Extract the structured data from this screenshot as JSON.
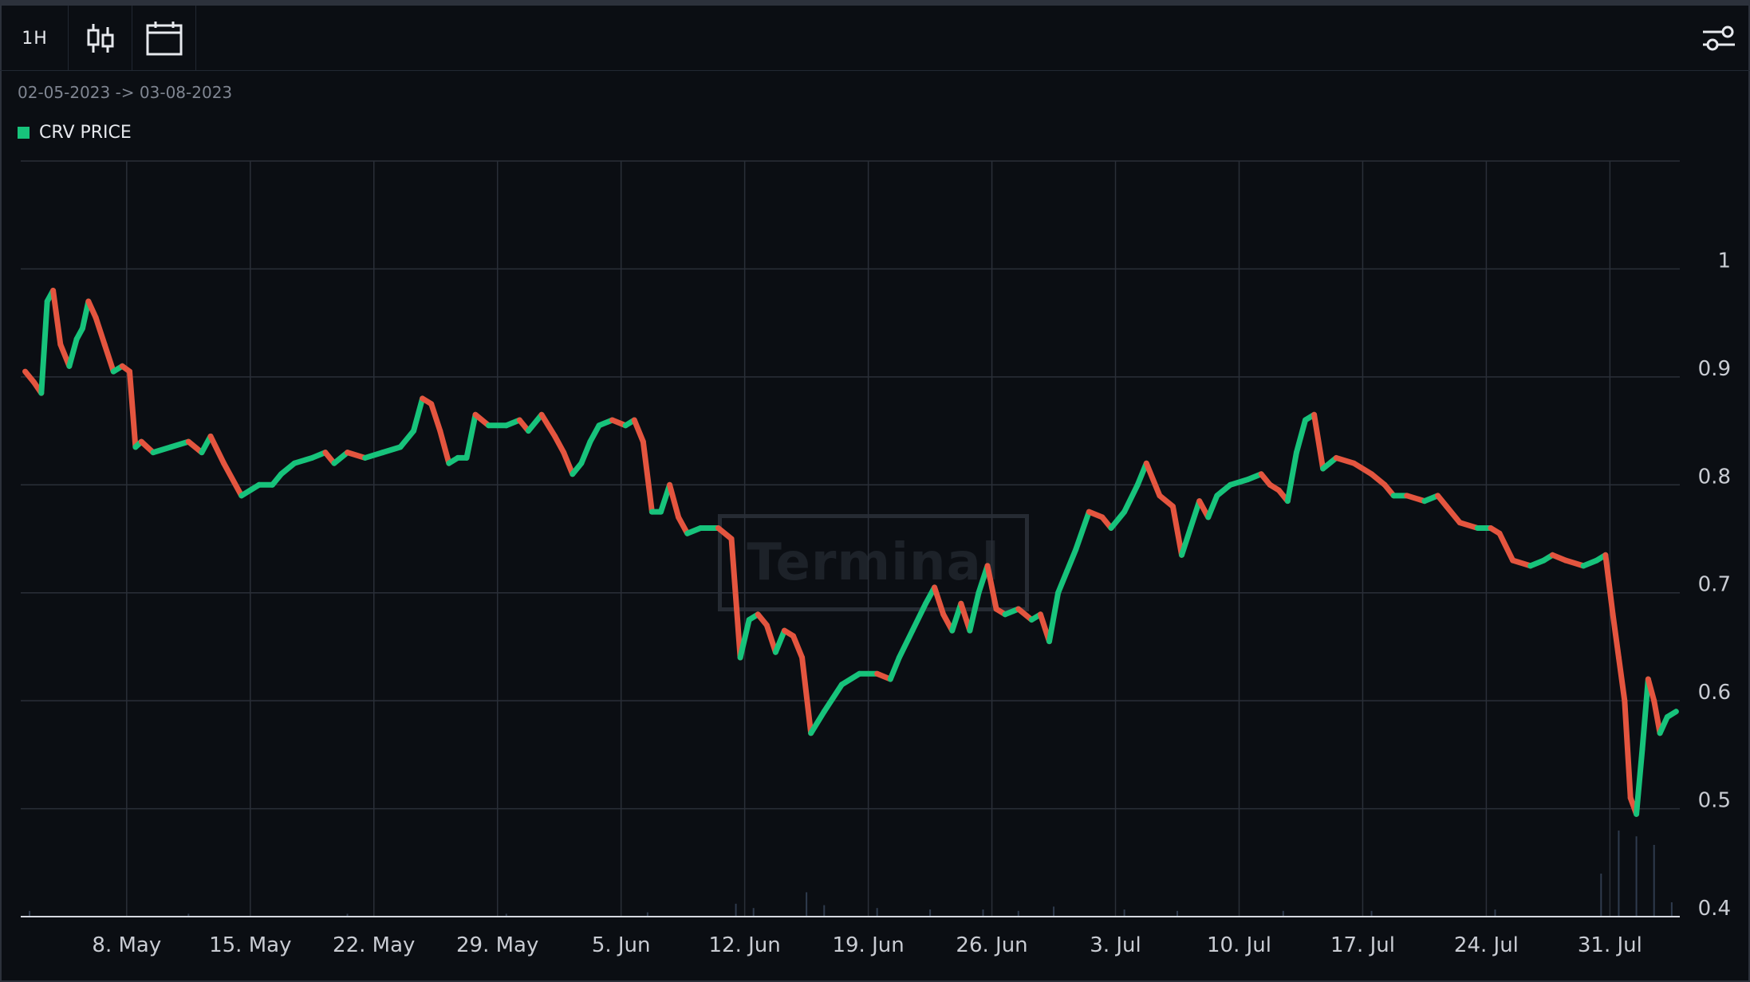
{
  "toolbar": {
    "interval_label": "1H",
    "candle_icon": "candlestick-icon",
    "calendar_icon": "calendar-icon",
    "settings_icon": "sliders-icon"
  },
  "date_range": "02-05-2023 -> 03-08-2023",
  "watermark": "Terminal",
  "colors": {
    "background": "#0b0e13",
    "grid": "#2a2f38",
    "up": "#17c37b",
    "down": "#e4553f",
    "volume": "#2f3b4e"
  },
  "chart_data": {
    "type": "line",
    "title": "",
    "legend": [
      {
        "name": "CRV PRICE",
        "color": "#17c37b"
      }
    ],
    "xlabel": "",
    "ylabel": "",
    "ylim": [
      0.4,
      1.1
    ],
    "yticks": [
      0.4,
      0.5,
      0.6,
      0.7,
      0.8,
      0.9,
      1
    ],
    "ytick_labels": [
      "0.4",
      "0.5",
      "0.6",
      "0.7",
      "0.8",
      "0.9",
      "1"
    ],
    "x_range": [
      "2023-05-02",
      "2023-08-03"
    ],
    "xticks": [
      "8. May",
      "15. May",
      "22. May",
      "29. May",
      "5. Jun",
      "12. Jun",
      "19. Jun",
      "26. Jun",
      "3. Jul",
      "10. Jul",
      "17. Jul",
      "24. Jul",
      "31. Jul"
    ],
    "xtick_dates": [
      "2023-05-08",
      "2023-05-15",
      "2023-05-22",
      "2023-05-29",
      "2023-06-05",
      "2023-06-12",
      "2023-06-19",
      "2023-06-26",
      "2023-07-03",
      "2023-07-10",
      "2023-07-17",
      "2023-07-24",
      "2023-07-31"
    ],
    "grid": true,
    "series": [
      {
        "name": "CRV PRICE",
        "points": [
          [
            "2023-05-02",
            0.905
          ],
          [
            "2023-05-02",
            0.895
          ],
          [
            "2023-05-03",
            0.885
          ],
          [
            "2023-05-03",
            0.97
          ],
          [
            "2023-05-03",
            0.98
          ],
          [
            "2023-05-04",
            0.93
          ],
          [
            "2023-05-04",
            0.91
          ],
          [
            "2023-05-05",
            0.935
          ],
          [
            "2023-05-05",
            0.945
          ],
          [
            "2023-05-05",
            0.97
          ],
          [
            "2023-05-06",
            0.955
          ],
          [
            "2023-05-06",
            0.93
          ],
          [
            "2023-05-07",
            0.905
          ],
          [
            "2023-05-07",
            0.91
          ],
          [
            "2023-05-08",
            0.905
          ],
          [
            "2023-05-08",
            0.835
          ],
          [
            "2023-05-08",
            0.84
          ],
          [
            "2023-05-09",
            0.83
          ],
          [
            "2023-05-10",
            0.835
          ],
          [
            "2023-05-11",
            0.84
          ],
          [
            "2023-05-12",
            0.83
          ],
          [
            "2023-05-12",
            0.845
          ],
          [
            "2023-05-13",
            0.82
          ],
          [
            "2023-05-14",
            0.79
          ],
          [
            "2023-05-15",
            0.8
          ],
          [
            "2023-05-16",
            0.8
          ],
          [
            "2023-05-16",
            0.81
          ],
          [
            "2023-05-17",
            0.82
          ],
          [
            "2023-05-18",
            0.825
          ],
          [
            "2023-05-19",
            0.83
          ],
          [
            "2023-05-19",
            0.82
          ],
          [
            "2023-05-20",
            0.83
          ],
          [
            "2023-05-21",
            0.825
          ],
          [
            "2023-05-22",
            0.83
          ],
          [
            "2023-05-23",
            0.835
          ],
          [
            "2023-05-24",
            0.85
          ],
          [
            "2023-05-24",
            0.88
          ],
          [
            "2023-05-25",
            0.875
          ],
          [
            "2023-05-25",
            0.85
          ],
          [
            "2023-05-26",
            0.82
          ],
          [
            "2023-05-26",
            0.825
          ],
          [
            "2023-05-27",
            0.825
          ],
          [
            "2023-05-27",
            0.865
          ],
          [
            "2023-05-28",
            0.855
          ],
          [
            "2023-05-29",
            0.855
          ],
          [
            "2023-05-30",
            0.86
          ],
          [
            "2023-05-30",
            0.85
          ],
          [
            "2023-05-31",
            0.865
          ],
          [
            "2023-06-01",
            0.845
          ],
          [
            "2023-06-01",
            0.83
          ],
          [
            "2023-06-02",
            0.81
          ],
          [
            "2023-06-02",
            0.82
          ],
          [
            "2023-06-03",
            0.84
          ],
          [
            "2023-06-03",
            0.855
          ],
          [
            "2023-06-04",
            0.86
          ],
          [
            "2023-06-05",
            0.855
          ],
          [
            "2023-06-05",
            0.86
          ],
          [
            "2023-06-06",
            0.84
          ],
          [
            "2023-06-06",
            0.775
          ],
          [
            "2023-06-07",
            0.775
          ],
          [
            "2023-06-07",
            0.8
          ],
          [
            "2023-06-08",
            0.77
          ],
          [
            "2023-06-08",
            0.755
          ],
          [
            "2023-06-09",
            0.76
          ],
          [
            "2023-06-10",
            0.76
          ],
          [
            "2023-06-11",
            0.75
          ],
          [
            "2023-06-11",
            0.64
          ],
          [
            "2023-06-12",
            0.675
          ],
          [
            "2023-06-12",
            0.68
          ],
          [
            "2023-06-13",
            0.67
          ],
          [
            "2023-06-13",
            0.645
          ],
          [
            "2023-06-14",
            0.665
          ],
          [
            "2023-06-14",
            0.66
          ],
          [
            "2023-06-15",
            0.64
          ],
          [
            "2023-06-15",
            0.57
          ],
          [
            "2023-06-16",
            0.59
          ],
          [
            "2023-06-17",
            0.615
          ],
          [
            "2023-06-18",
            0.625
          ],
          [
            "2023-06-19",
            0.625
          ],
          [
            "2023-06-20",
            0.62
          ],
          [
            "2023-06-20",
            0.64
          ],
          [
            "2023-06-21",
            0.665
          ],
          [
            "2023-06-22",
            0.69
          ],
          [
            "2023-06-22",
            0.705
          ],
          [
            "2023-06-23",
            0.68
          ],
          [
            "2023-06-23",
            0.665
          ],
          [
            "2023-06-24",
            0.69
          ],
          [
            "2023-06-24",
            0.665
          ],
          [
            "2023-06-25",
            0.7
          ],
          [
            "2023-06-25",
            0.725
          ],
          [
            "2023-06-26",
            0.685
          ],
          [
            "2023-06-26",
            0.68
          ],
          [
            "2023-06-27",
            0.685
          ],
          [
            "2023-06-28",
            0.675
          ],
          [
            "2023-06-28",
            0.68
          ],
          [
            "2023-06-29",
            0.655
          ],
          [
            "2023-06-29",
            0.7
          ],
          [
            "2023-06-30",
            0.72
          ],
          [
            "2023-06-30",
            0.74
          ],
          [
            "2023-07-01",
            0.775
          ],
          [
            "2023-07-02",
            0.77
          ],
          [
            "2023-07-02",
            0.76
          ],
          [
            "2023-07-03",
            0.775
          ],
          [
            "2023-07-04",
            0.8
          ],
          [
            "2023-07-04",
            0.82
          ],
          [
            "2023-07-05",
            0.79
          ],
          [
            "2023-07-06",
            0.78
          ],
          [
            "2023-07-06",
            0.735
          ],
          [
            "2023-07-07",
            0.76
          ],
          [
            "2023-07-07",
            0.785
          ],
          [
            "2023-07-08",
            0.77
          ],
          [
            "2023-07-08",
            0.79
          ],
          [
            "2023-07-09",
            0.8
          ],
          [
            "2023-07-10",
            0.805
          ],
          [
            "2023-07-11",
            0.81
          ],
          [
            "2023-07-11",
            0.8
          ],
          [
            "2023-07-12",
            0.795
          ],
          [
            "2023-07-12",
            0.785
          ],
          [
            "2023-07-13",
            0.83
          ],
          [
            "2023-07-13",
            0.86
          ],
          [
            "2023-07-14",
            0.865
          ],
          [
            "2023-07-14",
            0.815
          ],
          [
            "2023-07-15",
            0.825
          ],
          [
            "2023-07-16",
            0.82
          ],
          [
            "2023-07-17",
            0.81
          ],
          [
            "2023-07-18",
            0.8
          ],
          [
            "2023-07-18",
            0.79
          ],
          [
            "2023-07-19",
            0.79
          ],
          [
            "2023-07-20",
            0.785
          ],
          [
            "2023-07-21",
            0.79
          ],
          [
            "2023-07-21",
            0.78
          ],
          [
            "2023-07-22",
            0.765
          ],
          [
            "2023-07-23",
            0.76
          ],
          [
            "2023-07-24",
            0.76
          ],
          [
            "2023-07-24",
            0.755
          ],
          [
            "2023-07-25",
            0.73
          ],
          [
            "2023-07-26",
            0.725
          ],
          [
            "2023-07-27",
            0.73
          ],
          [
            "2023-07-27",
            0.735
          ],
          [
            "2023-07-28",
            0.73
          ],
          [
            "2023-07-29",
            0.725
          ],
          [
            "2023-07-30",
            0.73
          ],
          [
            "2023-07-30",
            0.735
          ],
          [
            "2023-07-31",
            0.68
          ],
          [
            "2023-07-31",
            0.64
          ],
          [
            "2023-07-31",
            0.6
          ],
          [
            "2023-08-01",
            0.51
          ],
          [
            "2023-08-01",
            0.495
          ],
          [
            "2023-08-01",
            0.555
          ],
          [
            "2023-08-02",
            0.62
          ],
          [
            "2023-08-02",
            0.6
          ],
          [
            "2023-08-02",
            0.57
          ],
          [
            "2023-08-03",
            0.585
          ],
          [
            "2023-08-03",
            0.59
          ]
        ]
      }
    ],
    "volume": [
      [
        "2023-05-02",
        0.04
      ],
      [
        "2023-05-11",
        0.02
      ],
      [
        "2023-05-20",
        0.02
      ],
      [
        "2023-05-29",
        0.02
      ],
      [
        "2023-06-06",
        0.03
      ],
      [
        "2023-06-11",
        0.09
      ],
      [
        "2023-06-12",
        0.06
      ],
      [
        "2023-06-15",
        0.17
      ],
      [
        "2023-06-16",
        0.08
      ],
      [
        "2023-06-19",
        0.06
      ],
      [
        "2023-06-22",
        0.05
      ],
      [
        "2023-06-25",
        0.05
      ],
      [
        "2023-06-27",
        0.04
      ],
      [
        "2023-06-29",
        0.07
      ],
      [
        "2023-07-03",
        0.05
      ],
      [
        "2023-07-06",
        0.04
      ],
      [
        "2023-07-12",
        0.04
      ],
      [
        "2023-07-17",
        0.04
      ],
      [
        "2023-07-24",
        0.05
      ],
      [
        "2023-07-30",
        0.3
      ],
      [
        "2023-07-31",
        0.6
      ],
      [
        "2023-08-01",
        0.56
      ],
      [
        "2023-08-02",
        0.5
      ],
      [
        "2023-08-03",
        0.1
      ]
    ]
  }
}
